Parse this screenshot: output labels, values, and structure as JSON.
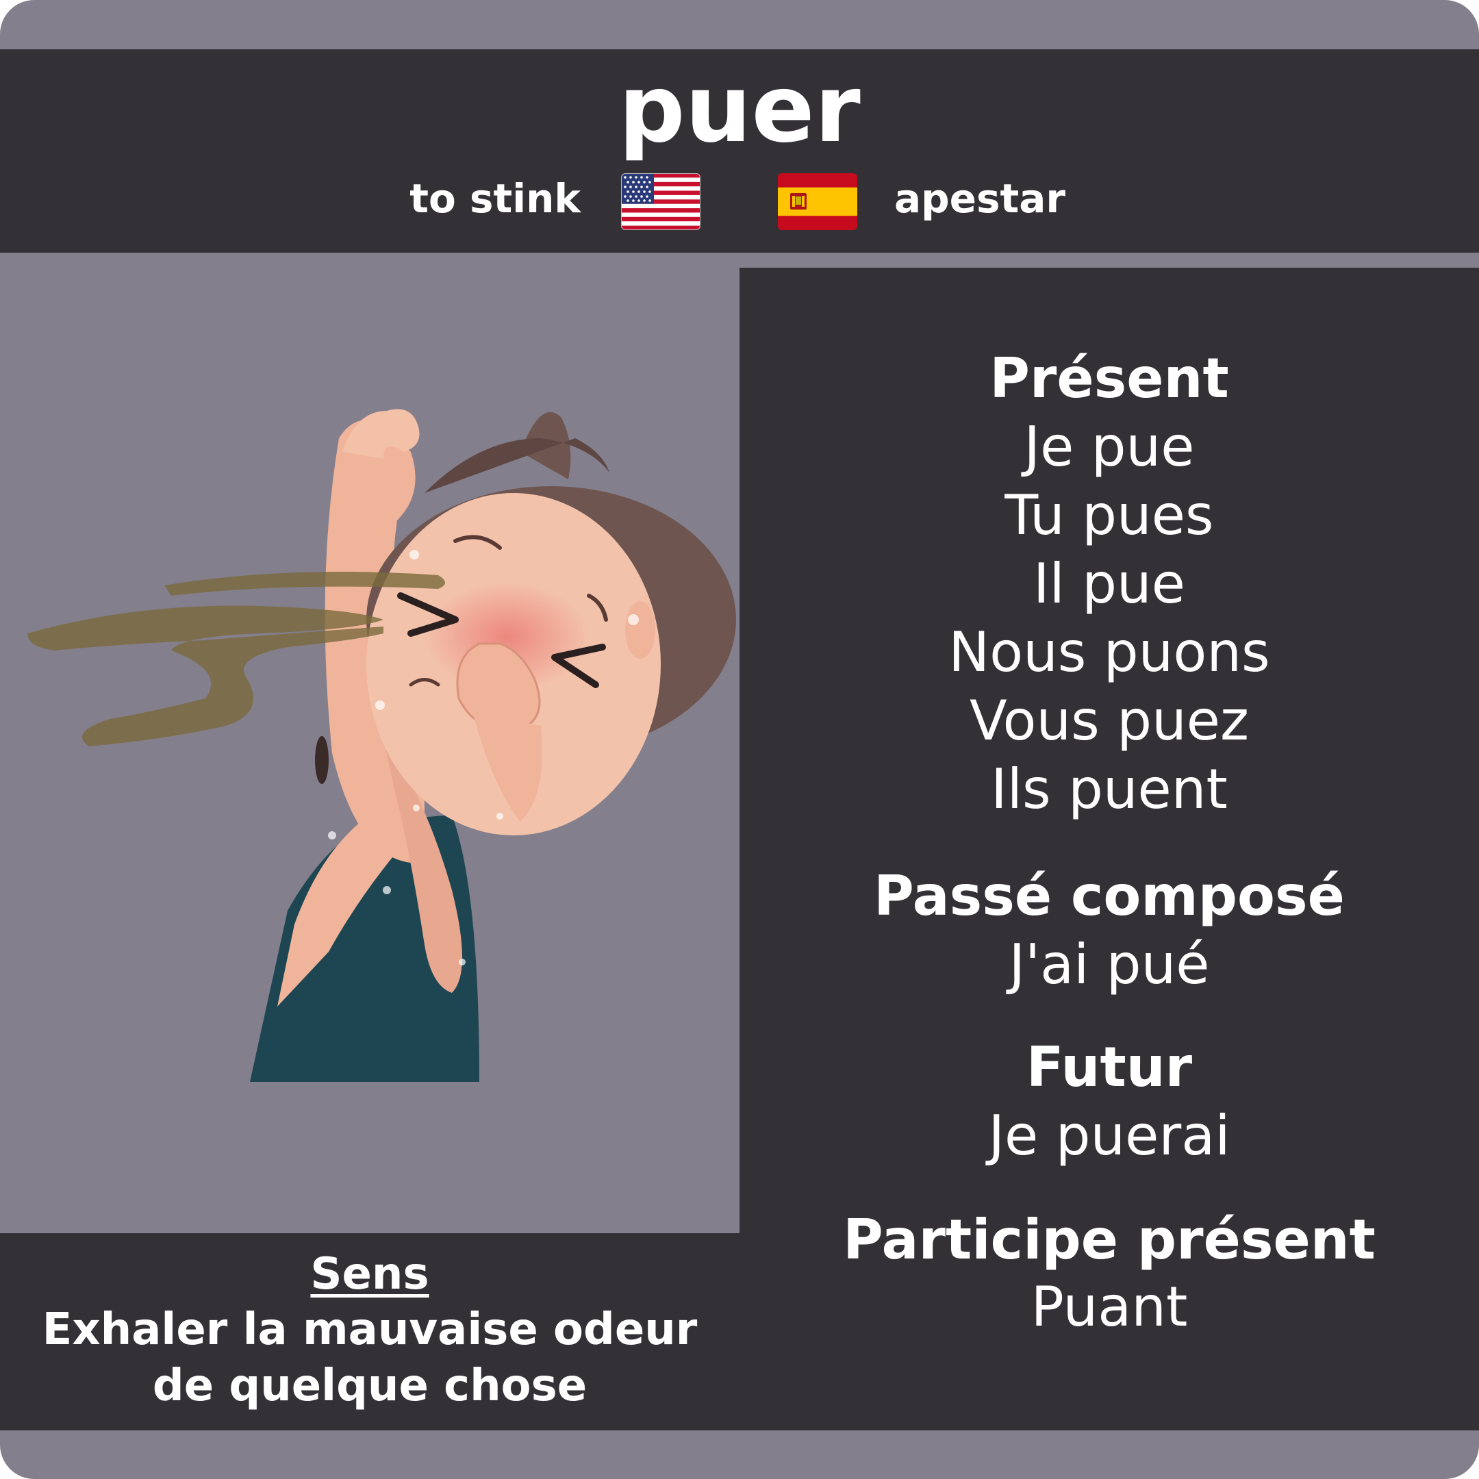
{
  "verb": "puer",
  "translations": {
    "english": "to stink",
    "spanish": "apestar",
    "english_flag": "us-flag-icon",
    "spanish_flag": "spain-flag-icon"
  },
  "illustration": "person-holding-nose-icon",
  "conjugation": {
    "present": {
      "heading": "Présent",
      "forms": [
        "Je pue",
        "Tu pues",
        "Il pue",
        "Nous puons",
        "Vous puez",
        "Ils puent"
      ]
    },
    "passe_compose": {
      "heading": "Passé composé",
      "form": "J'ai pué"
    },
    "futur": {
      "heading": "Futur",
      "form": "Je puerai"
    },
    "participe_present": {
      "heading": "Participe présent",
      "form": "Puant"
    }
  },
  "meaning": {
    "title": "Sens",
    "lines": [
      "Exhaler la mauvaise odeur",
      "de quelque chose"
    ]
  },
  "colors": {
    "background": "#847f8c",
    "panel": "#333136",
    "text": "#ffffff"
  }
}
